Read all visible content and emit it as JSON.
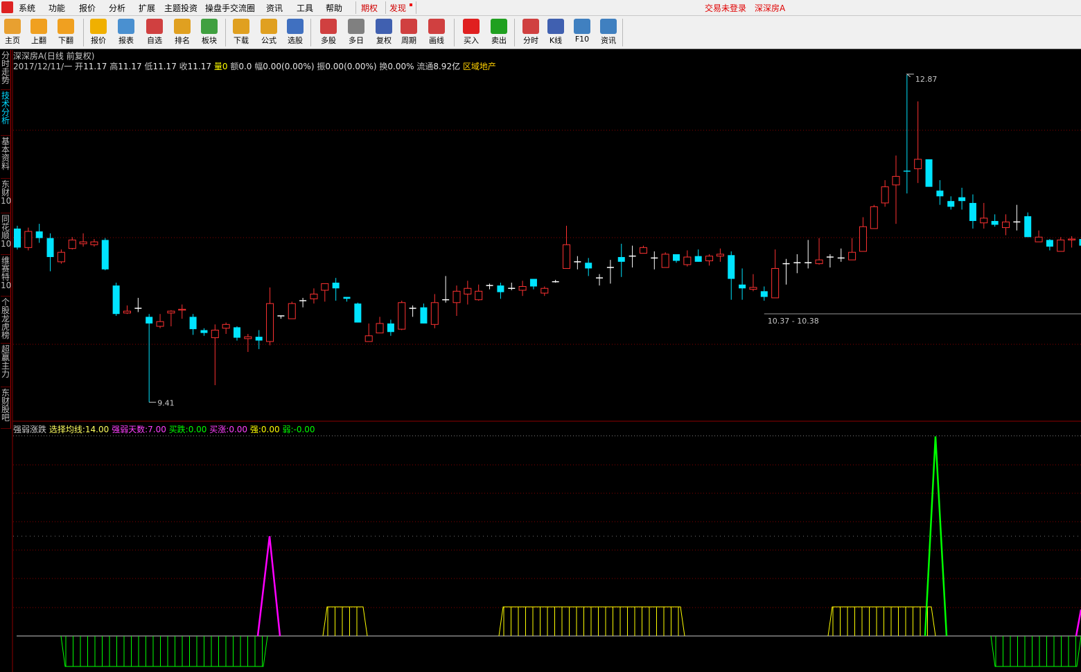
{
  "menubar": {
    "items": [
      "系统",
      "功能",
      "报价",
      "分析",
      "扩展",
      "主题投资",
      "操盘手交流圈",
      "资讯",
      "工具",
      "帮助"
    ],
    "options": "期权",
    "discover": "发现",
    "login_status": "交易未登录",
    "stock_name": "深深房A"
  },
  "toolbar": {
    "buttons": [
      {
        "label": "主页",
        "icon": "home-icon",
        "color": "#e8a030"
      },
      {
        "label": "上翻",
        "icon": "arrow-up-icon",
        "color": "#f0a020"
      },
      {
        "label": "下翻",
        "icon": "arrow-down-icon",
        "color": "#f0a020"
      },
      {
        "label": "报价",
        "icon": "yen-icon",
        "color": "#f0b000"
      },
      {
        "label": "报表",
        "icon": "report-icon",
        "color": "#4a90d0"
      },
      {
        "label": "自选",
        "icon": "f6-icon",
        "color": "#d04040"
      },
      {
        "label": "排名",
        "icon": "ranking-icon",
        "color": "#e0a020"
      },
      {
        "label": "板块",
        "icon": "sector-icon",
        "color": "#40a040"
      },
      {
        "label": "下载",
        "icon": "download-icon",
        "color": "#e0a020"
      },
      {
        "label": "公式",
        "icon": "formula-icon",
        "color": "#e0a020"
      },
      {
        "label": "选股",
        "icon": "stock-picker-icon",
        "color": "#4070c0"
      },
      {
        "label": "多股",
        "icon": "multi-stock-icon",
        "color": "#d04040"
      },
      {
        "label": "多日",
        "icon": "clock-icon",
        "color": "#808080"
      },
      {
        "label": "复权",
        "icon": "restore-rights-icon",
        "color": "#4060b0"
      },
      {
        "label": "周期",
        "icon": "f8-icon",
        "color": "#d04040"
      },
      {
        "label": "画线",
        "icon": "draw-line-icon",
        "color": "#d04040"
      },
      {
        "label": "买入",
        "icon": "buy-icon",
        "color": "#e02020"
      },
      {
        "label": "卖出",
        "icon": "sell-icon",
        "color": "#20a020"
      },
      {
        "label": "分时",
        "icon": "intraday-icon",
        "color": "#d04040"
      },
      {
        "label": "K线",
        "icon": "kline-icon",
        "color": "#4060b0"
      },
      {
        "label": "F10",
        "icon": "f10-icon",
        "color": "#4080c0"
      },
      {
        "label": "资讯",
        "icon": "news-icon",
        "color": "#4080c0"
      }
    ]
  },
  "left_tabs": [
    "分时走势",
    "技术分析",
    "基本资料",
    "东财10",
    "同花顺10",
    "维赛特10",
    "个股龙虎榜",
    "超赢主力",
    "东财股吧"
  ],
  "main_chart": {
    "title": "深深房A",
    "period": "(日线 前复权)",
    "info": {
      "date": "2017/12/11/一",
      "open_label": "开",
      "open": "11.17",
      "high_label": "高",
      "high": "11.17",
      "low_label": "低",
      "low": "11.17",
      "close_label": "收",
      "close": "11.17",
      "vol_label": "量",
      "vol": "0",
      "amount_label": "额",
      "amount": "0.0",
      "change_label": "幅",
      "change": "0.00(0.00%)",
      "amplitude_label": "振",
      "amplitude": "0.00(0.00%)",
      "turnover_label": "换",
      "turnover": "0.00%",
      "float_label": "流通",
      "float": "8.92亿",
      "sector": "区域地产"
    },
    "max_marker": "12.87",
    "min_marker": "9.41",
    "range_marker": "10.37 - 10.38"
  },
  "indicator": {
    "name": "强弱涨跌",
    "ma_label": "选择均线:",
    "ma_value": "14.00",
    "days_label": "强弱天数:",
    "days_value": "7.00",
    "buy_fall_label": "买跌:",
    "buy_fall_value": "0.00",
    "buy_rise_label": "买涨:",
    "buy_rise_value": "0.00",
    "strong_label": "强:",
    "strong_value": "0.00",
    "weak_label": "弱:",
    "weak_value": "-0.00"
  },
  "colors": {
    "up": "#ff3232",
    "down": "#00e4ff",
    "grid": "#8b0000",
    "magenta": "#ff00ff",
    "green": "#00ff00",
    "yellow": "#ffff00"
  },
  "chart_data": {
    "type": "candlestick",
    "y_range": [
      9.41,
      12.87
    ],
    "candles": [
      [
        11.25,
        11.05,
        11.28,
        11.03
      ],
      [
        11.05,
        11.22,
        11.26,
        11.02
      ],
      [
        11.22,
        11.15,
        11.3,
        11.1
      ],
      [
        11.15,
        10.95,
        11.2,
        10.8
      ],
      [
        10.9,
        11.0,
        11.03,
        10.88
      ],
      [
        11.04,
        11.13,
        11.16,
        11.03
      ],
      [
        11.09,
        11.11,
        11.2,
        11.06
      ],
      [
        11.08,
        11.11,
        11.14,
        11.06
      ],
      [
        11.13,
        10.82,
        11.15,
        10.81
      ],
      [
        10.65,
        10.35,
        10.68,
        10.33
      ],
      [
        10.36,
        10.38,
        10.44,
        10.35
      ],
      [
        10.41,
        10.41,
        10.52,
        10.37
      ],
      [
        10.32,
        10.25,
        10.35,
        9.42
      ],
      [
        10.22,
        10.27,
        10.35,
        10.2
      ],
      [
        10.36,
        10.38,
        10.39,
        10.22
      ],
      [
        10.39,
        10.4,
        10.45,
        10.3
      ],
      [
        10.32,
        10.19,
        10.35,
        10.13
      ],
      [
        10.18,
        10.15,
        10.2,
        10.12
      ],
      [
        10.1,
        10.18,
        10.24,
        9.6
      ],
      [
        10.2,
        10.24,
        10.26,
        10.14
      ],
      [
        10.21,
        10.1,
        10.22,
        10.07
      ],
      [
        10.09,
        10.11,
        10.14,
        9.95
      ],
      [
        10.11,
        10.07,
        10.18,
        9.98
      ],
      [
        10.06,
        10.46,
        10.63,
        10.02
      ],
      [
        10.33,
        10.33,
        10.33,
        10.3
      ],
      [
        10.3,
        10.46,
        10.48,
        10.3
      ],
      [
        10.49,
        10.49,
        10.52,
        10.42
      ],
      [
        10.51,
        10.56,
        10.62,
        10.46
      ],
      [
        10.6,
        10.67,
        10.67,
        10.48
      ],
      [
        10.68,
        10.62,
        10.73,
        10.49
      ],
      [
        10.53,
        10.51,
        10.53,
        10.48
      ],
      [
        10.46,
        10.26,
        10.47,
        10.26
      ],
      [
        10.06,
        10.12,
        10.25,
        10.06
      ],
      [
        10.15,
        10.25,
        10.32,
        10.15
      ],
      [
        10.25,
        10.16,
        10.29,
        10.12
      ],
      [
        10.19,
        10.47,
        10.49,
        10.18
      ],
      [
        10.41,
        10.41,
        10.32,
        10.44
      ],
      [
        10.42,
        10.25,
        10.46,
        10.25
      ],
      [
        10.24,
        10.47,
        10.56,
        10.2
      ],
      [
        10.5,
        10.5,
        10.75,
        10.47
      ],
      [
        10.47,
        10.59,
        10.65,
        10.33
      ],
      [
        10.56,
        10.62,
        10.7,
        10.45
      ],
      [
        10.5,
        10.59,
        10.66,
        10.49
      ],
      [
        10.65,
        10.65,
        10.67,
        10.61
      ],
      [
        10.65,
        10.58,
        10.68,
        10.51
      ],
      [
        10.62,
        10.62,
        10.68,
        10.6
      ],
      [
        10.6,
        10.64,
        10.7,
        10.54
      ],
      [
        10.72,
        10.64,
        10.71,
        10.61
      ],
      [
        10.57,
        10.62,
        10.64,
        10.54
      ],
      [
        10.69,
        10.69,
        10.71,
        10.68
      ],
      [
        10.83,
        11.08,
        11.28,
        10.83
      ],
      [
        10.9,
        10.9,
        10.96,
        10.82
      ],
      [
        10.89,
        10.83,
        10.94,
        10.75
      ],
      [
        10.73,
        10.73,
        10.77,
        10.65
      ],
      [
        10.84,
        10.84,
        10.92,
        10.67
      ],
      [
        10.95,
        10.9,
        11.09,
        10.74
      ],
      [
        10.96,
        10.96,
        11.07,
        10.84
      ],
      [
        10.99,
        11.05,
        11.07,
        10.99
      ],
      [
        10.94,
        10.94,
        11.01,
        10.82
      ],
      [
        10.84,
        10.98,
        11.0,
        10.84
      ],
      [
        10.98,
        10.91,
        10.97,
        10.89
      ],
      [
        10.87,
        10.95,
        11.02,
        10.85
      ],
      [
        10.96,
        10.9,
        11.03,
        10.9
      ],
      [
        10.91,
        10.96,
        10.98,
        10.86
      ],
      [
        10.96,
        10.98,
        11.04,
        10.9
      ],
      [
        10.97,
        10.72,
        11.01,
        10.5
      ],
      [
        10.66,
        10.62,
        10.83,
        10.5
      ],
      [
        10.61,
        10.63,
        10.77,
        10.59
      ],
      [
        10.59,
        10.53,
        10.64,
        10.49
      ],
      [
        10.52,
        10.83,
        11.03,
        10.52
      ],
      [
        10.88,
        10.88,
        10.93,
        10.66
      ],
      [
        10.89,
        10.89,
        10.98,
        10.78
      ],
      [
        10.89,
        10.89,
        11.13,
        10.83
      ],
      [
        10.88,
        10.92,
        11.15,
        10.87
      ],
      [
        10.95,
        10.95,
        10.98,
        10.84
      ],
      [
        10.94,
        10.94,
        11.04,
        10.9
      ],
      [
        10.92,
        11.0,
        11.15,
        10.95
      ],
      [
        11.01,
        11.27,
        11.37,
        11.19
      ],
      [
        11.25,
        11.48,
        11.5,
        11.33
      ],
      [
        11.52,
        11.69,
        11.76,
        11.48
      ],
      [
        11.71,
        11.8,
        12.02,
        11.3
      ],
      [
        11.86,
        11.85,
        12.87,
        11.62
      ],
      [
        11.88,
        11.98,
        12.59,
        11.73
      ],
      [
        11.98,
        11.69,
        11.98,
        11.71
      ],
      [
        11.65,
        11.59,
        11.76,
        11.5
      ],
      [
        11.54,
        11.48,
        11.59,
        11.45
      ],
      [
        11.58,
        11.54,
        11.68,
        11.45
      ],
      [
        11.52,
        11.33,
        11.61,
        11.25
      ],
      [
        11.31,
        11.36,
        11.52,
        11.25
      ],
      [
        11.33,
        11.29,
        11.4,
        11.27
      ],
      [
        11.26,
        11.32,
        11.4,
        11.18
      ],
      [
        11.32,
        11.32,
        11.5,
        11.23
      ],
      [
        11.38,
        11.16,
        11.42,
        11.2
      ],
      [
        11.11,
        11.16,
        11.23,
        11.11
      ],
      [
        11.13,
        11.06,
        11.14,
        11.02
      ],
      [
        11.01,
        11.13,
        11.16,
        11.01
      ],
      [
        11.13,
        11.14,
        11.17,
        11.05
      ],
      [
        11.14,
        11.07,
        11.15,
        11.06
      ],
      [
        11.08,
        10.95,
        11.13,
        10.94
      ],
      [
        10.85,
        11.17,
        11.34,
        10.81
      ]
    ]
  }
}
